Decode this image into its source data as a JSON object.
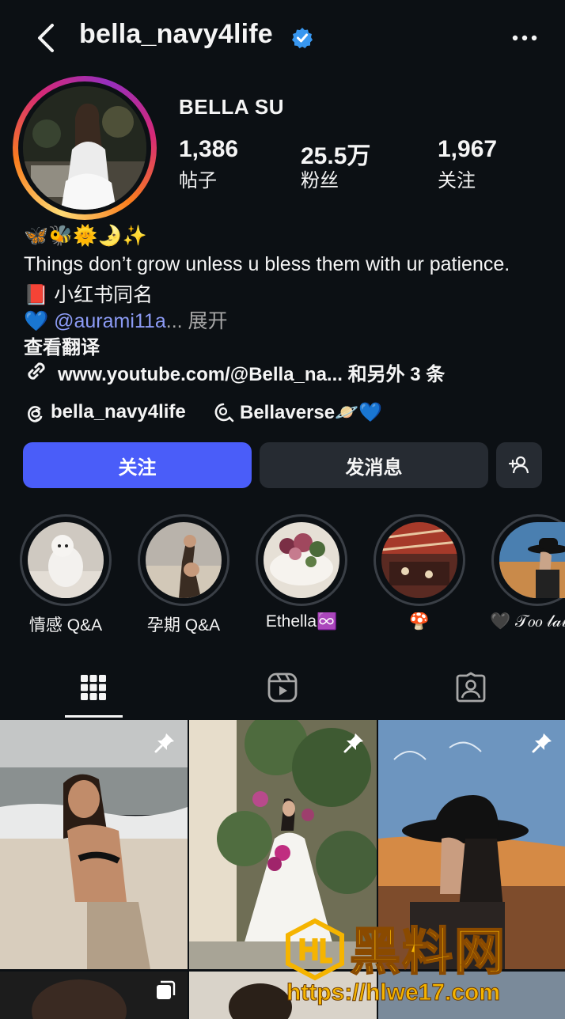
{
  "header": {
    "username": "bella_navy4life",
    "verified": true,
    "icons": [
      "back-arrow-icon",
      "verified-badge-icon",
      "more-options-icon"
    ]
  },
  "profile": {
    "display_name": "BELLA SU",
    "stats": [
      {
        "value": "1,386",
        "label": "帖子"
      },
      {
        "value": "25.5万",
        "label": "粉丝"
      },
      {
        "value": "1,967",
        "label": "关注"
      }
    ]
  },
  "bio": {
    "emoji_line": "🦋🐝🌞🌛✨",
    "line1": "Things don’t grow unless u bless them with ur patience.",
    "line2_emoji": "📕",
    "line2": "小红书同名",
    "line3_emoji": "💙",
    "line3_mention": "@aurami11a",
    "line3_ellipsis": "...",
    "line3_more": "展开",
    "translate": "查看翻译",
    "link": "www.youtube.com/@Bella_na... 和另外 3 条",
    "threads_handle": "bella_navy4life",
    "channel": "Bellaverse🪐💙"
  },
  "actions": {
    "follow": "关注",
    "message": "发消息"
  },
  "highlights": [
    {
      "label": "情感 Q&A"
    },
    {
      "label": "孕期 Q&A"
    },
    {
      "label": "Ethella♾️"
    },
    {
      "label": "🍄"
    },
    {
      "label": "🖤 𝒯𝑜𝑜 𝓁𝒶𝓉𝑒"
    }
  ],
  "tabs": [
    "grid-icon",
    "reels-icon",
    "tagged-icon"
  ],
  "watermark": {
    "brand": "黑料网",
    "url": "https://hlwe17.com"
  },
  "colors": {
    "background": "#0c1014",
    "follow_button": "#4a5df9",
    "secondary_button": "#262b32",
    "mention": "#8c9bf5",
    "verified": "#3897f0"
  }
}
